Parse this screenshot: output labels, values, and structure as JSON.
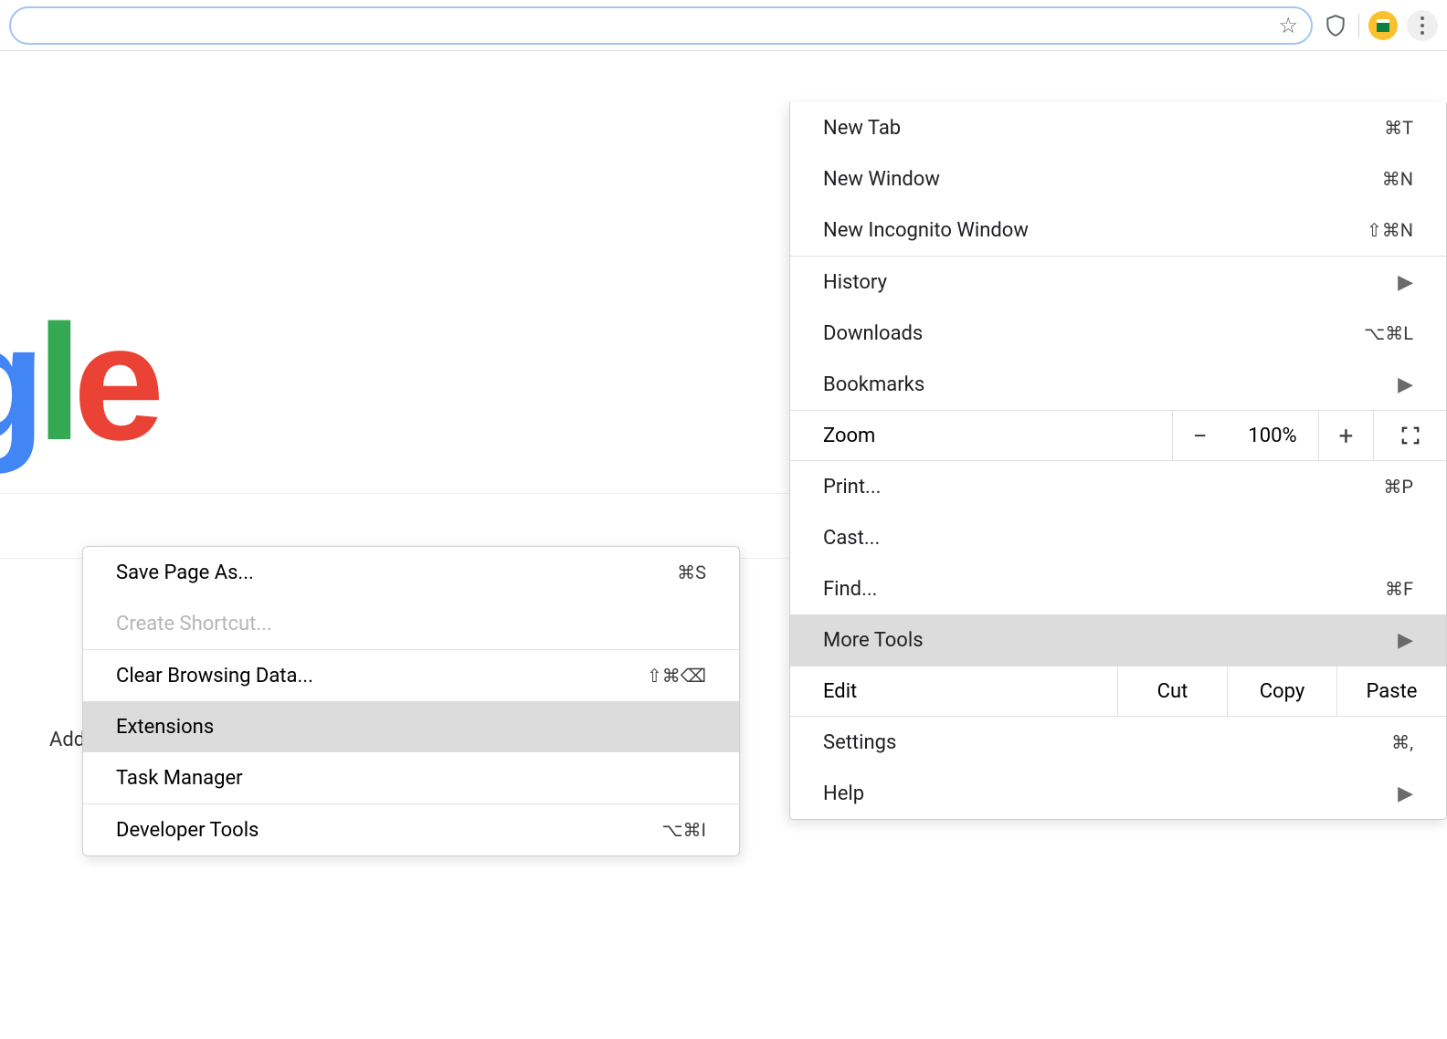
{
  "toolbar": {
    "address_value": "",
    "star_title": "Bookmark this page"
  },
  "page": {
    "logo_fragment": "gle",
    "add_shortcut_fragment": "Add s"
  },
  "menu": {
    "items_a": [
      {
        "label": "New Tab",
        "shortcut": "⌘T"
      },
      {
        "label": "New Window",
        "shortcut": "⌘N"
      },
      {
        "label": "New Incognito Window",
        "shortcut": "⇧⌘N"
      }
    ],
    "items_b": [
      {
        "label": "History",
        "arrow": true
      },
      {
        "label": "Downloads",
        "shortcut": "⌥⌘L"
      },
      {
        "label": "Bookmarks",
        "arrow": true
      }
    ],
    "zoom": {
      "label": "Zoom",
      "minus": "−",
      "value": "100%",
      "plus": "+"
    },
    "items_c": [
      {
        "label": "Print...",
        "shortcut": "⌘P"
      },
      {
        "label": "Cast..."
      },
      {
        "label": "Find...",
        "shortcut": "⌘F"
      },
      {
        "label": "More Tools",
        "arrow": true,
        "highlight": true
      }
    ],
    "edit": {
      "label": "Edit",
      "cut": "Cut",
      "copy": "Copy",
      "paste": "Paste"
    },
    "items_d": [
      {
        "label": "Settings",
        "shortcut": "⌘,"
      },
      {
        "label": "Help",
        "arrow": true
      }
    ]
  },
  "submenu": {
    "rows": [
      {
        "label": "Save Page As...",
        "shortcut": "⌘S"
      },
      {
        "label": "Create Shortcut...",
        "disabled": true
      },
      {
        "sep": true
      },
      {
        "label": "Clear Browsing Data...",
        "shortcut": "⇧⌘⌫"
      },
      {
        "label": "Extensions",
        "highlight": true
      },
      {
        "label": "Task Manager"
      },
      {
        "sep": true
      },
      {
        "label": "Developer Tools",
        "shortcut": "⌥⌘I"
      }
    ]
  }
}
